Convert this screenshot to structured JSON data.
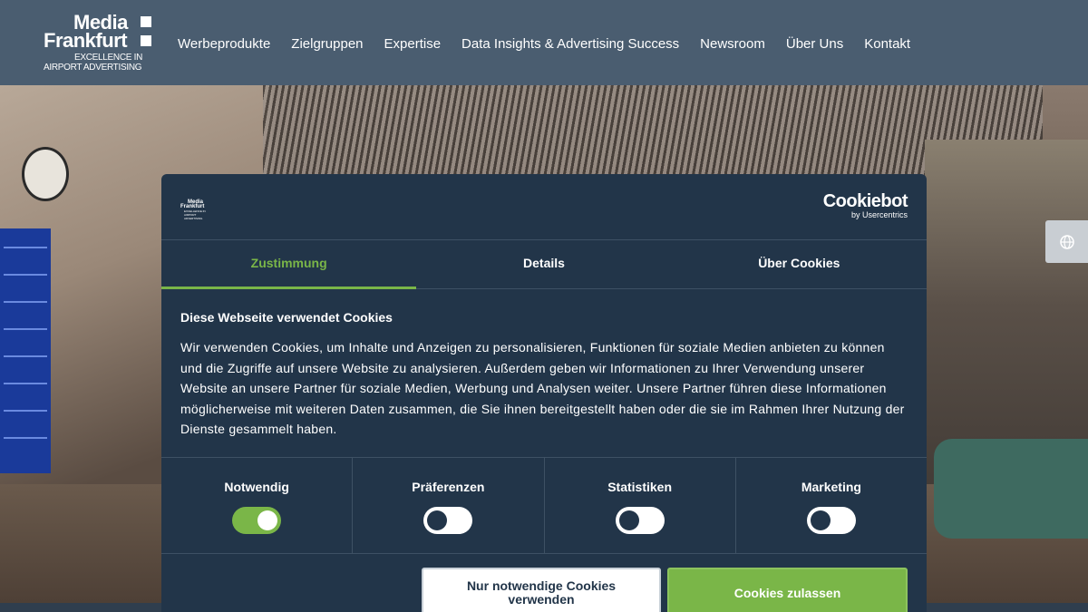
{
  "header": {
    "logo": {
      "line1": "Media",
      "line2": "Frankfurt",
      "tagline1": "EXCELLENCE IN",
      "tagline2": "AIRPORT ADVERTISING"
    },
    "nav": [
      "Werbeprodukte",
      "Zielgruppen",
      "Expertise",
      "Data Insights & Advertising Success",
      "Newsroom",
      "Über Uns",
      "Kontakt"
    ]
  },
  "language_button": {
    "icon": "globe-icon"
  },
  "cookie_dialog": {
    "mini_logo": {
      "line1": "Media",
      "line2": "Frankfurt",
      "tagline": "EXCELLENCE IN AIRPORT ADVERTISING"
    },
    "provider": {
      "name": "Cookiebot",
      "sub": "by Usercentrics"
    },
    "tabs": [
      {
        "label": "Zustimmung",
        "active": true
      },
      {
        "label": "Details",
        "active": false
      },
      {
        "label": "Über Cookies",
        "active": false
      }
    ],
    "heading": "Diese Webseite verwendet Cookies",
    "body": "Wir verwenden Cookies, um Inhalte und Anzeigen zu personalisieren, Funktionen für soziale Medien anbieten zu können und die Zugriffe auf unsere Website zu analysieren. Außerdem geben wir Informationen zu Ihrer Verwendung unserer Website an unsere Partner für soziale Medien, Werbung und Analysen weiter. Unsere Partner führen diese Informationen möglicherweise mit weiteren Daten zusammen, die Sie ihnen bereitgestellt haben oder die sie im Rahmen Ihrer Nutzung der Dienste gesammelt haben.",
    "categories": [
      {
        "label": "Notwendig",
        "enabled": true
      },
      {
        "label": "Präferenzen",
        "enabled": false
      },
      {
        "label": "Statistiken",
        "enabled": false
      },
      {
        "label": "Marketing",
        "enabled": false
      }
    ],
    "buttons": {
      "necessary_only": "Nur notwendige Cookies verwenden",
      "allow_all": "Cookies zulassen"
    }
  },
  "colors": {
    "header_bg": "#4a5d70",
    "dialog_bg": "#223549",
    "accent_green": "#7ab648"
  }
}
